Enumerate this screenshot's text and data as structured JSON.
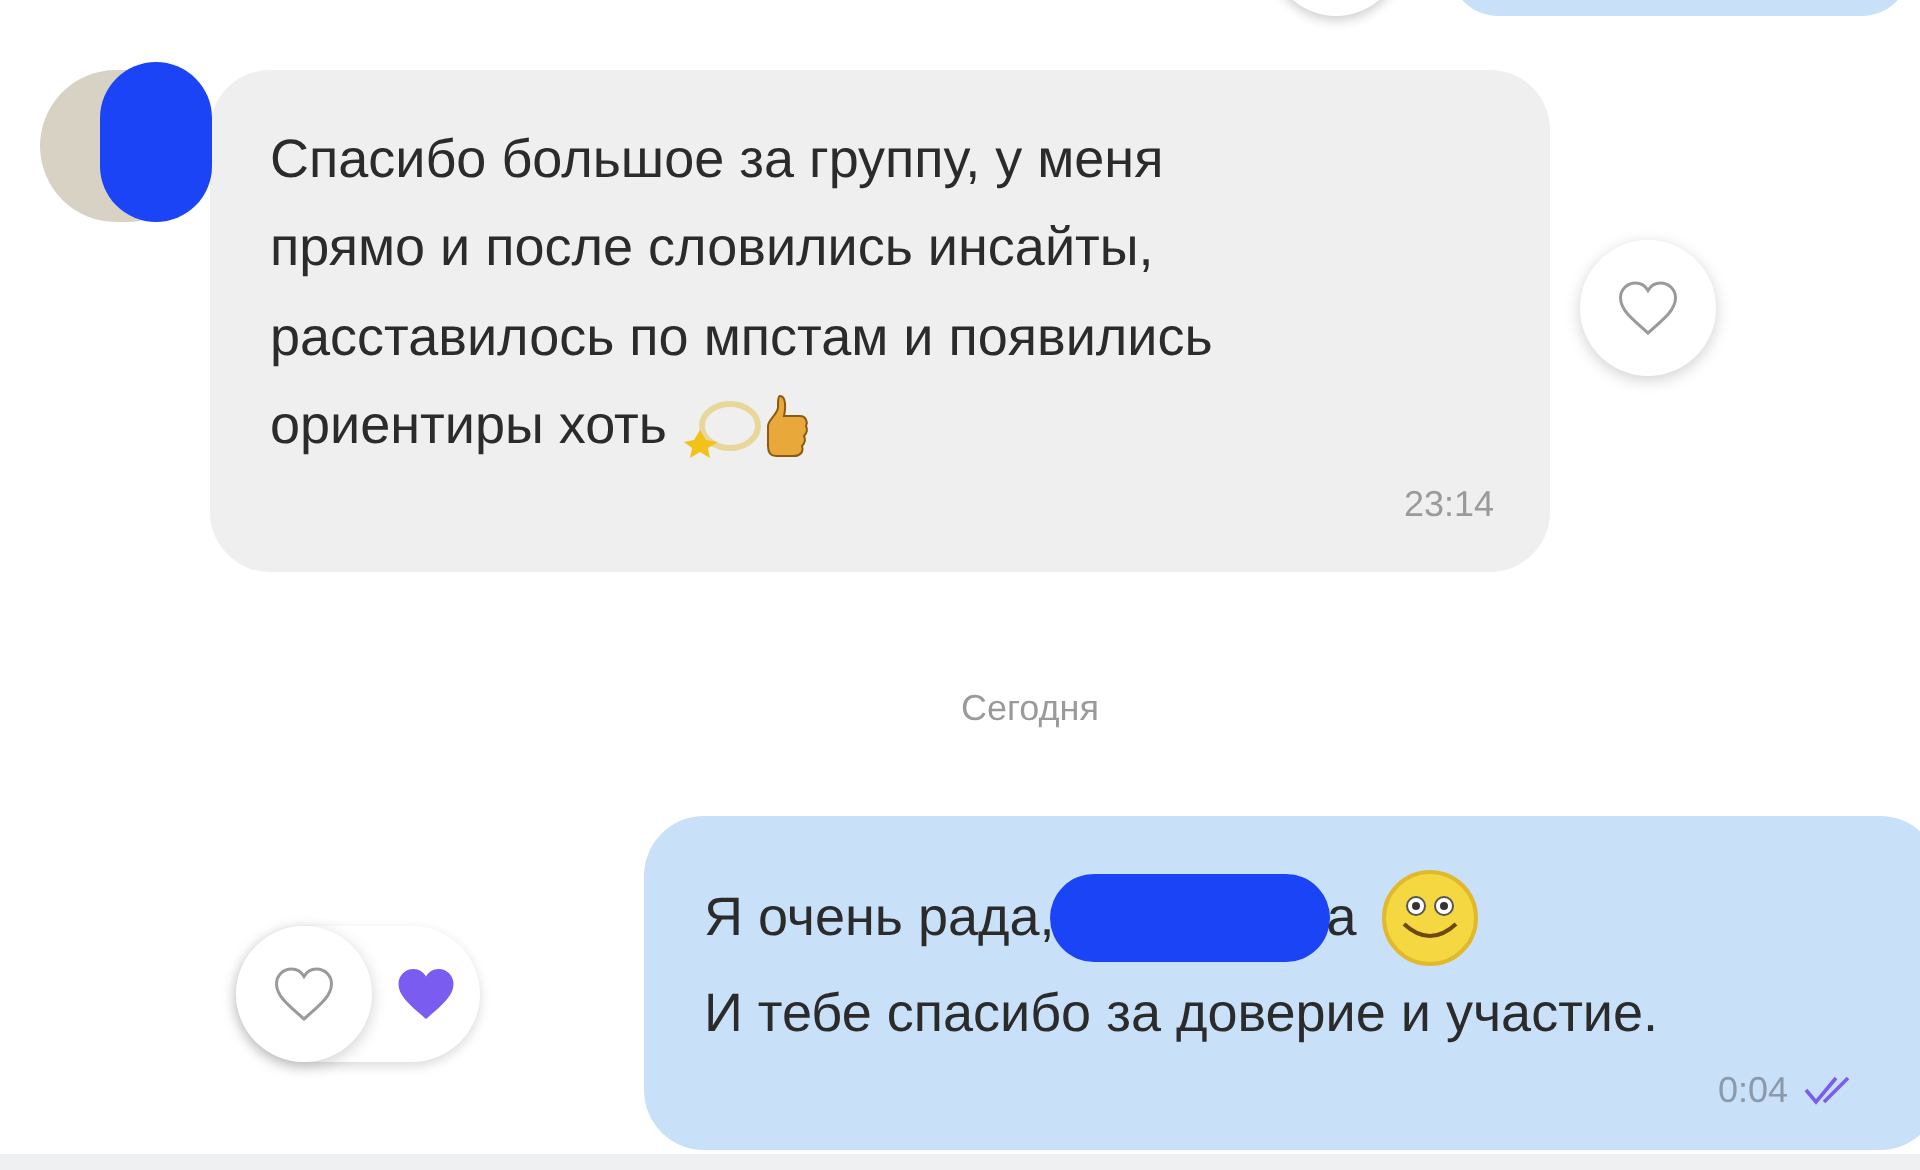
{
  "messages": [
    {
      "kind": "incoming",
      "segments": [
        {
          "kind": "text",
          "text": "Спасибо большое за группу, у меня"
        },
        {
          "kind": "break"
        },
        {
          "kind": "text",
          "text": "прямо и после словились инсайты,"
        },
        {
          "kind": "break"
        },
        {
          "kind": "text",
          "text": "расставилось по мпстам и появились"
        },
        {
          "kind": "break"
        },
        {
          "kind": "text",
          "text": "ориентиры хоть"
        },
        {
          "kind": "comet-emoji"
        },
        {
          "kind": "thumbs-up-emoji"
        }
      ],
      "time": "23:14",
      "reactions": [
        {
          "kind": "like-button",
          "selected": false
        }
      ]
    },
    {
      "kind": "date",
      "text": "Сегодня"
    },
    {
      "kind": "outgoing",
      "segments": [
        {
          "kind": "text",
          "text": "Я очень рада,"
        },
        {
          "kind": "redaction"
        },
        {
          "kind": "text",
          "text": "а"
        },
        {
          "kind": "smile-emoji"
        },
        {
          "kind": "break"
        },
        {
          "kind": "text",
          "text": "И тебе спасибо за доверие и участие."
        }
      ],
      "time": "0:04",
      "read": true,
      "reactions": [
        {
          "kind": "like-button",
          "selected": false
        },
        {
          "kind": "heart",
          "selected": true
        }
      ]
    }
  ]
}
